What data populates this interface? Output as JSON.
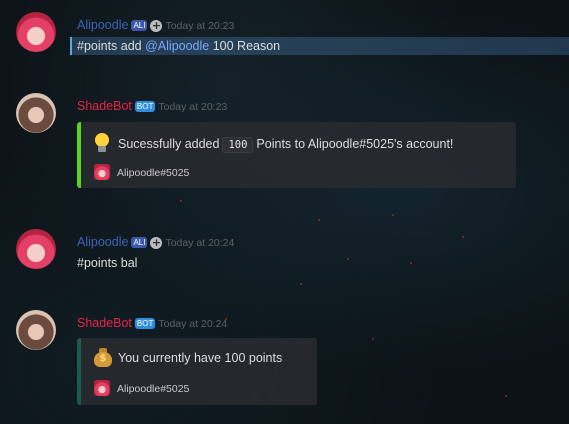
{
  "messages": [
    {
      "author": "Alipoodle",
      "tag": "ALI",
      "time": "Today at 20:23",
      "text_prefix": "#points add ",
      "mention": "@Alipoodle",
      "text_suffix": " 100 Reason"
    },
    {
      "author": "ShadeBot",
      "tag": "BOT",
      "time": "Today at 20:23",
      "embed": {
        "icon": "lightbulb-icon",
        "text_before": "Sucessfully added",
        "code": "100",
        "text_after": "Points to Alipoodle#5025's account!",
        "footer": "Alipoodle#5025",
        "accent": "#5bd21f"
      }
    },
    {
      "author": "Alipoodle",
      "tag": "ALI",
      "time": "Today at 20:24",
      "text": "#points bal"
    },
    {
      "author": "ShadeBot",
      "tag": "BOT",
      "time": "Today at 20:24",
      "embed": {
        "icon": "money-bag-icon",
        "text": "You currently have 100 points",
        "footer": "Alipoodle#5025",
        "accent": "#1b5a4e"
      }
    }
  ],
  "colors": {
    "alipoodle_name": "#3d63b5",
    "shadebot_name": "#e9244b",
    "mention_highlight": "#5aa8e0"
  }
}
